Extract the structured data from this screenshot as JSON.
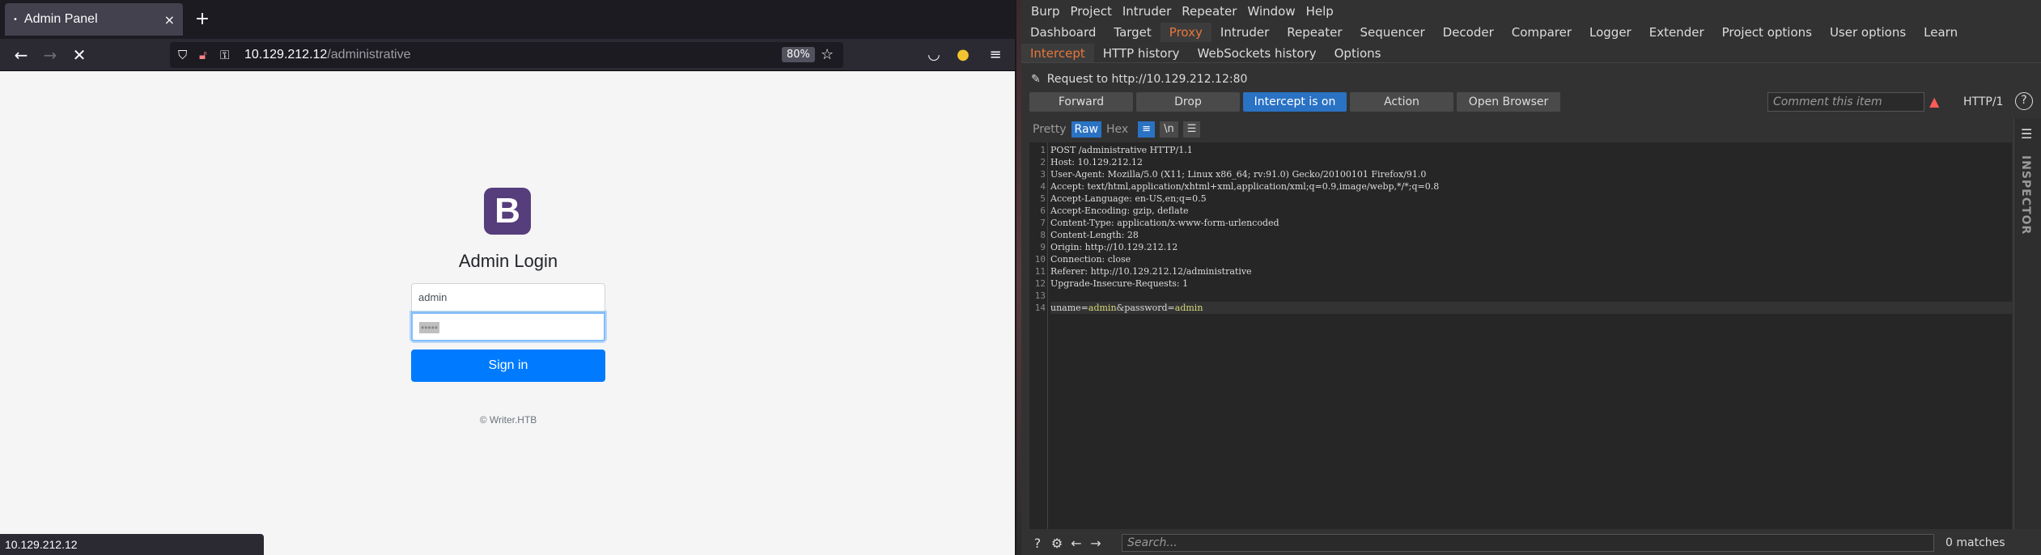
{
  "firefox": {
    "tab": {
      "title": "Admin Panel",
      "close_glyph": "×",
      "dot": "•"
    },
    "new_tab_glyph": "+",
    "url_host": "10.129.212.12",
    "url_path": "/administrative",
    "zoom": "80%",
    "status_text": "10.129.212.12"
  },
  "page": {
    "logo_letter": "B",
    "heading": "Admin Login",
    "username_value": "admin",
    "password_value": "•••••",
    "signin_label": "Sign in",
    "copyright": "© Writer.HTB"
  },
  "burp": {
    "menu": [
      "Burp",
      "Project",
      "Intruder",
      "Repeater",
      "Window",
      "Help"
    ],
    "main_tabs": [
      {
        "label": "Dashboard",
        "active": false
      },
      {
        "label": "Target",
        "active": false
      },
      {
        "label": "Proxy",
        "active": true
      },
      {
        "label": "Intruder",
        "active": false
      },
      {
        "label": "Repeater",
        "active": false
      },
      {
        "label": "Sequencer",
        "active": false
      },
      {
        "label": "Decoder",
        "active": false
      },
      {
        "label": "Comparer",
        "active": false
      },
      {
        "label": "Logger",
        "active": false
      },
      {
        "label": "Extender",
        "active": false
      },
      {
        "label": "Project options",
        "active": false
      },
      {
        "label": "User options",
        "active": false
      },
      {
        "label": "Learn",
        "active": false
      }
    ],
    "sub_tabs": [
      {
        "label": "Intercept",
        "active": true
      },
      {
        "label": "HTTP history",
        "active": false
      },
      {
        "label": "WebSockets history",
        "active": false
      },
      {
        "label": "Options",
        "active": false
      }
    ],
    "request_to": "Request to http://10.129.212.12:80",
    "actions": {
      "forward": "Forward",
      "drop": "Drop",
      "intercept": "Intercept is on",
      "action": "Action",
      "open_browser": "Open Browser"
    },
    "comment_placeholder": "Comment this item",
    "http_version": "HTTP/1",
    "help": "?",
    "view_modes": {
      "pretty": "Pretty",
      "raw": "Raw",
      "hex": "Hex"
    },
    "view_icons": {
      "wrap": "≡",
      "newline": "\\n",
      "menu": "☰"
    },
    "request_lines": [
      "POST /administrative HTTP/1.1",
      "Host: 10.129.212.12",
      "User-Agent: Mozilla/5.0 (X11; Linux x86_64; rv:91.0) Gecko/20100101 Firefox/91.0",
      "Accept: text/html,application/xhtml+xml,application/xml;q=0.9,image/webp,*/*;q=0.8",
      "Accept-Language: en-US,en;q=0.5",
      "Accept-Encoding: gzip, deflate",
      "Content-Type: application/x-www-form-urlencoded",
      "Content-Length: 28",
      "Origin: http://10.129.212.12",
      "Connection: close",
      "Referer: http://10.129.212.12/administrative",
      "Upgrade-Insecure-Requests: 1",
      "",
      "uname=admin&password=admin"
    ],
    "line_numbers": [
      "1",
      "2",
      "3",
      "4",
      "5",
      "6",
      "7",
      "8",
      "9",
      "10",
      "11",
      "12",
      "13",
      "14"
    ],
    "inspector_label": "INSPECTOR",
    "search_placeholder": "Search...",
    "matches": "0 matches"
  },
  "colors": {
    "burp_accent": "#e8773a",
    "intercept_on": "#2a72c4",
    "bootstrap_primary": "#007bff",
    "bootstrap_logo": "#563d7c"
  }
}
